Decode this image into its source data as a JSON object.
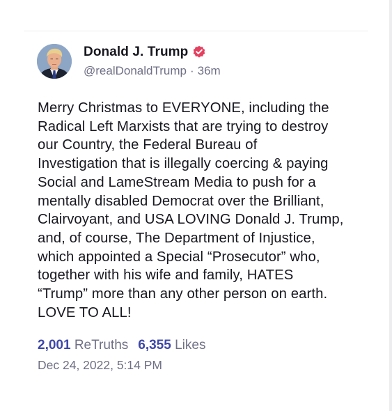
{
  "post": {
    "author": {
      "display_name": "Donald J. Trump",
      "handle": "@realDonaldTrump",
      "separator": "·",
      "relative_time": "36m",
      "verified": true,
      "avatar_icon": "profile-photo"
    },
    "body": "Merry Christmas to EVERYONE, including the\nRadical Left Marxists that are trying to destroy\nour Country, the Federal Bureau of\nInvestigation that is illegally coercing & paying\nSocial and LameStream Media to push for a\nmentally disabled Democrat over the Brilliant,\nClairvoyant, and USA LOVING Donald J. Trump,\nand, of course, The Department of Injustice,\nwhich appointed a Special “Prosecutor” who,\ntogether with his wife and family, HATES\n“Trump” more than any other person on earth.\nLOVE TO ALL!",
    "stats": {
      "retruths_count": "2,001",
      "retruths_label": "ReTruths",
      "likes_count": "6,355",
      "likes_label": "Likes"
    },
    "timestamp": "Dec 24, 2022, 5:14 PM"
  },
  "colors": {
    "verified_badge": "#e4405f",
    "stat_count": "#3d47a8",
    "muted_text": "#6f6f86",
    "body_text": "#17171f"
  }
}
